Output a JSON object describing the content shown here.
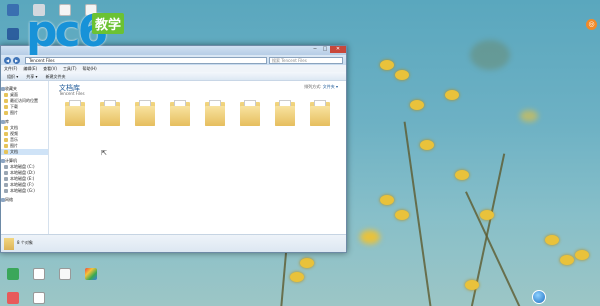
{
  "explorer": {
    "address_path": "Tencent Files",
    "search_placeholder": "搜索 Tencent Files",
    "menu": [
      "文件(F)",
      "编辑(E)",
      "查看(V)",
      "工具(T)",
      "帮助(H)"
    ],
    "toolbar": [
      "组织 ▾",
      "共享 ▾",
      "新建文件夹"
    ],
    "nav": {
      "favorites": {
        "label": "收藏夹",
        "items": [
          "桌面",
          "最近访问的位置",
          "下载",
          "图片"
        ]
      },
      "libraries": {
        "label": "库",
        "items": [
          "文档",
          "视频",
          "音乐",
          "图片",
          "文档"
        ]
      },
      "computer": {
        "label": "计算机",
        "items": [
          "本地磁盘 (C:)",
          "本地磁盘 (D:)",
          "本地磁盘 (E:)",
          "本地磁盘 (F:)",
          "本地磁盘 (G:)"
        ]
      },
      "network": {
        "label": "网络"
      }
    },
    "library_title": "文档库",
    "library_subtitle": "Tencent Files",
    "arrange_label": "排列方式:",
    "arrange_value": "文件夹 ▾",
    "folder_count": 8,
    "status_text": "8 个对象"
  },
  "watermark": {
    "brand": "pc6",
    "badge": "教学"
  },
  "window_controls": {
    "minimize": "─",
    "maximize": "□",
    "close": "✕"
  },
  "nav_buttons": {
    "back": "◀",
    "forward": "▶"
  },
  "cursor_glyph": "⇱",
  "orange_button": "◎",
  "desktop_icons": [
    "icon-1",
    "icon-2",
    "icon-3",
    "icon-4",
    "icon-5",
    "icon-6",
    "icon-7",
    "icon-8"
  ],
  "colors": {
    "accent": "#1792d8",
    "badge": "#6bc233",
    "folder": "#e6be5e",
    "close": "#c8473a"
  }
}
